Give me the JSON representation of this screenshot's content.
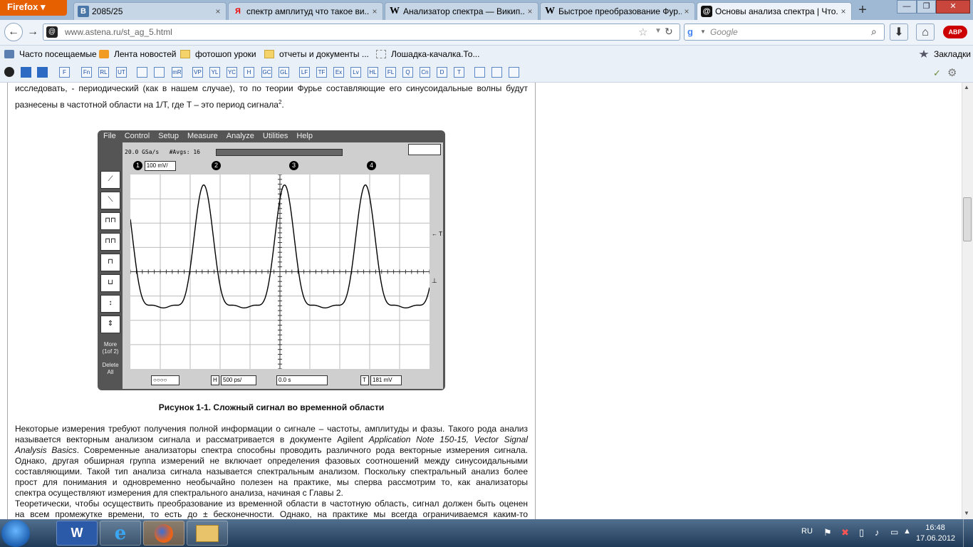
{
  "browser": {
    "menu_label": "Firefox",
    "tabs": [
      {
        "label": "2085/25",
        "icon": "В"
      },
      {
        "label": "спектр амплитуд что такое ви...",
        "icon": "Я"
      },
      {
        "label": "Анализатор спектра — Викип...",
        "icon": "W"
      },
      {
        "label": "Быстрое преобразование Фур...",
        "icon": "W"
      },
      {
        "label": "Основы анализа спектра | Что...",
        "icon": "@"
      }
    ],
    "tab_close": "×",
    "new_tab": "+",
    "url": "www.astena.ru/st_ag_5.html",
    "search_placeholder": "Google",
    "abp_label": "ABP"
  },
  "bookmarks": [
    {
      "label": "Часто посещаемые"
    },
    {
      "label": "Лента новостей"
    },
    {
      "label": "фотошоп уроки"
    },
    {
      "label": "отчеты и документы ..."
    },
    {
      "label": "Лошадка-качалка.То..."
    }
  ],
  "bookmarks_menu": "Закладки",
  "toolbar3": [
    "F",
    "Fn",
    "RL",
    "UT",
    "",
    "",
    "mR",
    "VP",
    "YL",
    "YC",
    "H",
    "GC",
    "GL",
    "LF",
    "TF",
    "Ex",
    "Lv",
    "HL",
    "FL",
    "Q",
    "Cn",
    "D",
    "T",
    "",
    "",
    ""
  ],
  "article": {
    "p1_line1": "исследовать, - периодический (как в нашем случае), то по теории Фурье составляющие его синусоидальные волны будут",
    "p1_line2": "разнесены в частотной области на 1/T, где T – это период сигнала",
    "p1_sup": "2",
    "p1_end": ".",
    "caption": "Рисунок 1-1. Сложный сигнал во временной области",
    "p2": [
      "Некоторые измерения требуют получения полной информации о сигнале – частоты, амплитуды и фазы. Такого рода анализ",
      "называется векторным анализом сигнала и рассматривается в документе Agilent",
      "Application Note 150-15, Vector Signal",
      "Analysis Basics",
      ". Современные анализаторы спектра способны проводить различного рода векторные измерения сигнала.",
      "Однако, другая обширная группа измерений не включает определения фазовых соотношений между синусоидальными",
      "составляющими. Такой тип анализа сигнала называется спектральным анализом. Поскольку спектральный анализ более",
      "прост для понимания и одновременно необычайно полезен на практике, мы сперва рассмотрим то, как анализаторы",
      "спектра осуществляют измерения для спектрального анализа, начиная с Главы 2."
    ],
    "p3": [
      "Теоретически, чтобы осуществить преобразование из временной области в частотную область, сигнал должен быть оценен",
      "на всем промежутке времени, то есть до ± бесконечности. Однако, на практике мы всегда ограничиваемся каким-то"
    ]
  },
  "scope": {
    "menu": [
      "File",
      "Control",
      "Setup",
      "Measure",
      "Analyze",
      "Utilities",
      "Help"
    ],
    "status": "20.0 GSa/s   #Avgs: 16",
    "channels": [
      "1",
      "2",
      "3",
      "4"
    ],
    "ch1_scale": "100 mV/",
    "side_more": "More (1of 2)",
    "side_delete": "Delete All",
    "trigger_marker": "← T",
    "time_scale": "500 ps/",
    "time_pos": "0.0 s",
    "trig_level": "181 mV",
    "h_label": "H",
    "t_label": "T"
  },
  "taskbar": {
    "lang": "RU",
    "time": "16:48",
    "date": "17.06.2012"
  }
}
